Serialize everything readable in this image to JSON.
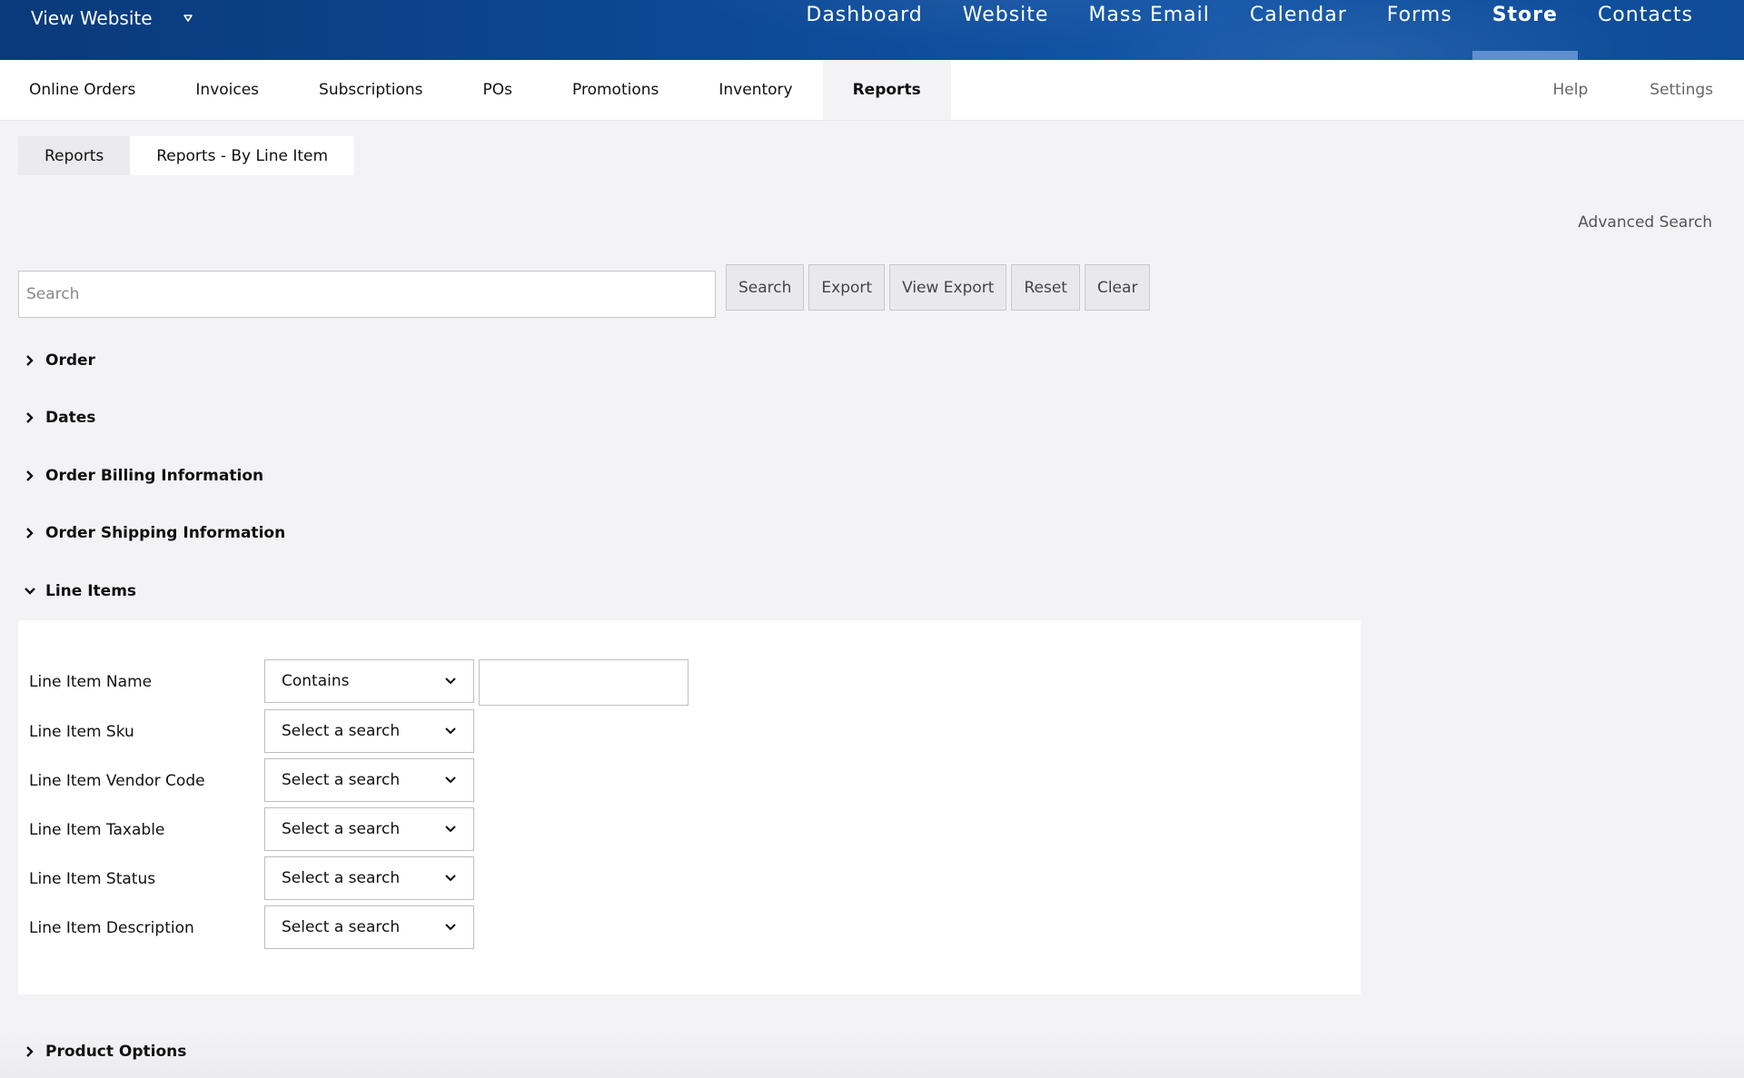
{
  "topbar": {
    "view_website": "View Website",
    "nav": [
      {
        "label": "Dashboard"
      },
      {
        "label": "Website"
      },
      {
        "label": "Mass Email"
      },
      {
        "label": "Calendar"
      },
      {
        "label": "Forms"
      },
      {
        "label": "Store"
      },
      {
        "label": "Contacts"
      }
    ]
  },
  "subnav": {
    "items": [
      {
        "label": "Online Orders"
      },
      {
        "label": "Invoices"
      },
      {
        "label": "Subscriptions"
      },
      {
        "label": "POs"
      },
      {
        "label": "Promotions"
      },
      {
        "label": "Inventory"
      },
      {
        "label": "Reports"
      }
    ],
    "help": "Help",
    "settings": "Settings"
  },
  "report_tabs": {
    "reports": "Reports",
    "by_line_item": "Reports - By Line Item"
  },
  "advanced_search": "Advanced Search",
  "search": {
    "placeholder": "Search",
    "value": ""
  },
  "buttons": {
    "search": "Search",
    "export": "Export",
    "view_export": "View Export",
    "reset": "Reset",
    "clear": "Clear"
  },
  "sections": {
    "order": "Order",
    "dates": "Dates",
    "billing": "Order Billing Information",
    "shipping": "Order Shipping Information",
    "line_items": "Line Items",
    "product_options": "Product Options"
  },
  "line_items": {
    "fields": [
      {
        "label": "Line Item Name",
        "selected": "Contains",
        "value": ""
      },
      {
        "label": "Line Item Sku",
        "selected": "Select a search"
      },
      {
        "label": "Line Item Vendor Code",
        "selected": "Select a search"
      },
      {
        "label": "Line Item Taxable",
        "selected": "Select a search"
      },
      {
        "label": "Line Item Status",
        "selected": "Select a search"
      },
      {
        "label": "Line Item Description",
        "selected": "Select a search"
      }
    ]
  }
}
